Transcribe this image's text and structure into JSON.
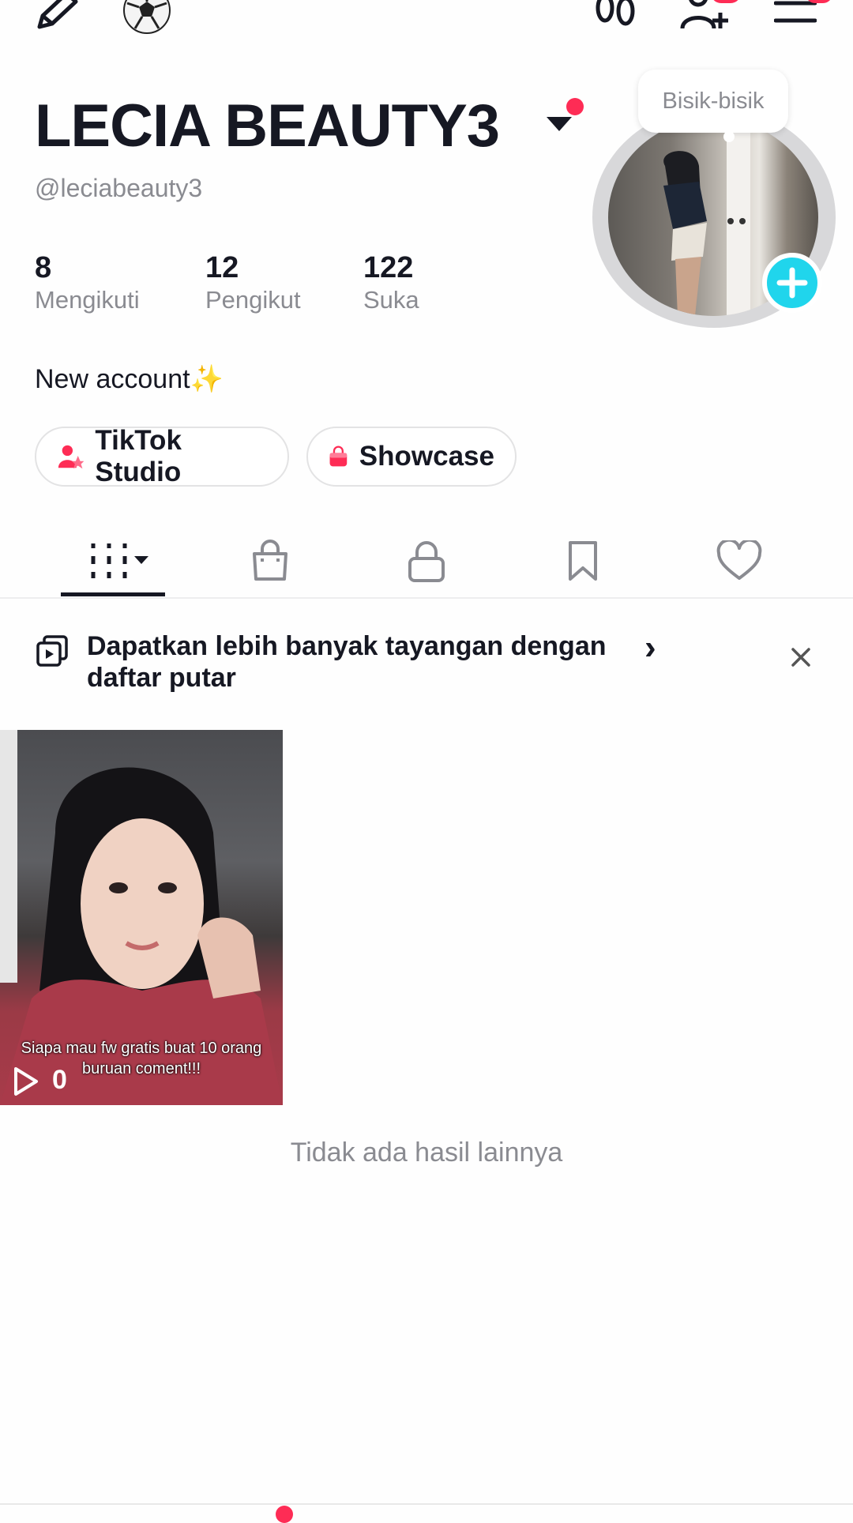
{
  "profile": {
    "display_name": "LECIA BEAUTY3",
    "username": "@leciabeauty3",
    "bio": "New account✨",
    "avatar_bubble": "Bisik-bisik"
  },
  "stats": [
    {
      "value": "8",
      "label": "Mengikuti"
    },
    {
      "value": "12",
      "label": "Pengikut"
    },
    {
      "value": "122",
      "label": "Suka"
    }
  ],
  "chips": [
    {
      "label": "TikTok Studio",
      "icon": "studio-icon"
    },
    {
      "label": "Showcase",
      "icon": "shopping-bag-icon"
    }
  ],
  "tabs": [
    {
      "name": "videos",
      "icon": "grid-icon",
      "active": true
    },
    {
      "name": "shop",
      "icon": "shopping-bag-icon"
    },
    {
      "name": "private",
      "icon": "lock-icon"
    },
    {
      "name": "saved",
      "icon": "bookmark-icon"
    },
    {
      "name": "liked",
      "icon": "heart-icon"
    }
  ],
  "promo": {
    "text": "Dapatkan lebih banyak tayangan dengan daftar putar",
    "arrow": "›"
  },
  "videos": [
    {
      "caption": "Siapa mau fw gratis buat 10 orang buruan coment!!!",
      "views": "0"
    }
  ],
  "footer_text": "Tidak ada hasil lainnya",
  "colors": {
    "accent": "#fe2c55",
    "cyan": "#20d5ec",
    "text": "#161823",
    "muted": "#8a8b91"
  }
}
